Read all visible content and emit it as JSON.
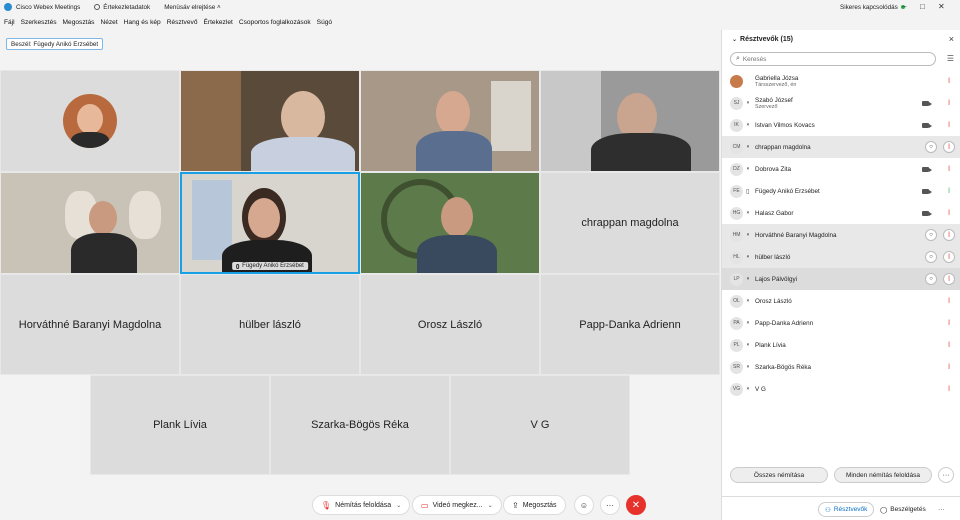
{
  "titlebar": {
    "app_name": "Cisco Webex Meetings",
    "meeting_info": "Értekezletadatok",
    "hide_menu": "Menüsáv elrejtése",
    "connection": "Sikeres kapcsolódás"
  },
  "menu": [
    "Fájl",
    "Szerkesztés",
    "Megosztás",
    "Nézet",
    "Hang és kép",
    "Résztvevő",
    "Értekezlet",
    "Csoportos foglalkozások",
    "Súgó"
  ],
  "speaker": "Beszél: Fügedy Anikó Erzsébet",
  "tiles": {
    "t5_label": "Fügedy Anikó Erzsébet",
    "chrappan": "chrappan magdolna",
    "horvathne": "Horváthné Baranyi Magdolna",
    "hulber": "hülber lászló",
    "orosz": "Orosz László",
    "pappdanka": "Papp-Danka Adrienn",
    "plank": "Plank Lívia",
    "szarka": "Szarka-Bögös Réka",
    "vg": "V G"
  },
  "toolbar": {
    "unmute": "Némítás feloldása",
    "video": "Videó megkez...",
    "share": "Megosztás"
  },
  "panel": {
    "title": "Résztvevők (15)",
    "search_placeholder": "Keresés",
    "participants": [
      {
        "initials": "",
        "name": "Gabriella Józsa",
        "role": "Társszervező, én"
      },
      {
        "initials": "SJ",
        "name": "Szabó József",
        "role": "Szervező"
      },
      {
        "initials": "IK",
        "name": "Istvan Vilmos Kovacs",
        "role": ""
      },
      {
        "initials": "CM",
        "name": "chrappan magdolna",
        "role": ""
      },
      {
        "initials": "DZ",
        "name": "Dobrova Zita",
        "role": ""
      },
      {
        "initials": "FE",
        "name": "Fügedy Anikó Erzsébet",
        "role": ""
      },
      {
        "initials": "HG",
        "name": "Halasz Gabor",
        "role": ""
      },
      {
        "initials": "HM",
        "name": "Horváthné Baranyi Magdolna",
        "role": ""
      },
      {
        "initials": "HL",
        "name": "hülber lászló",
        "role": ""
      },
      {
        "initials": "LP",
        "name": "Lajos Pálvölgyi",
        "role": ""
      },
      {
        "initials": "OL",
        "name": "Orosz László",
        "role": ""
      },
      {
        "initials": "PA",
        "name": "Papp-Danka Adrienn",
        "role": ""
      },
      {
        "initials": "PL",
        "name": "Plank Lívia",
        "role": ""
      },
      {
        "initials": "SR",
        "name": "Szarka-Bögös Réka",
        "role": ""
      },
      {
        "initials": "VG",
        "name": "V G",
        "role": ""
      }
    ],
    "mute_all": "Összes némítása",
    "unmute_all": "Minden némítás feloldása",
    "tab_participants": "Résztvevők",
    "tab_chat": "Beszélgetés"
  }
}
